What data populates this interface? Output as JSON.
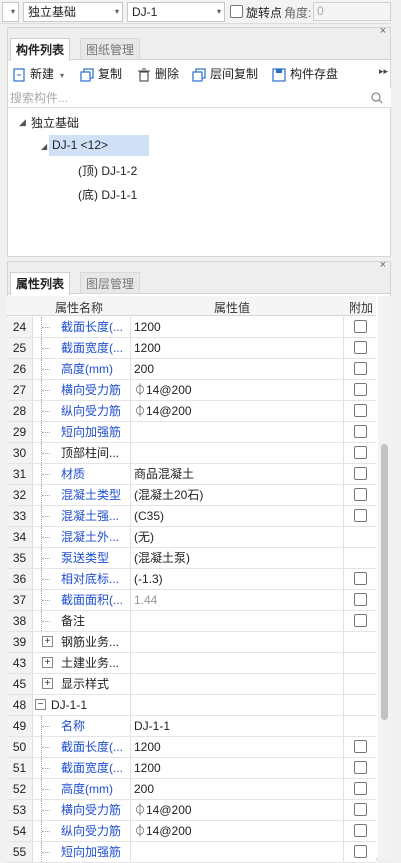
{
  "toolbar": {
    "category": "独立基础",
    "component": "DJ-1",
    "rotate_point_label": "旋转点",
    "angle_label": "角度:",
    "angle_value": "0"
  },
  "component_panel": {
    "tabs": [
      "构件列表",
      "图纸管理"
    ],
    "actions": {
      "new": "新建",
      "copy": "复制",
      "delete": "删除",
      "floor_copy": "层间复制",
      "save": "构件存盘"
    },
    "search_placeholder": "搜索构件...",
    "tree": {
      "root": "独立基础",
      "selected": "DJ-1 <12>",
      "children": [
        "(顶) DJ-1-2",
        "(底) DJ-1-1"
      ]
    }
  },
  "property_panel": {
    "tabs": [
      "属性列表",
      "图层管理"
    ],
    "columns": [
      "属性名称",
      "属性值",
      "附加"
    ],
    "rows": [
      {
        "num": "24",
        "name": "截面长度(...",
        "value": "1200",
        "style": "blue",
        "check": true
      },
      {
        "num": "25",
        "name": "截面宽度(...",
        "value": "1200",
        "style": "blue",
        "check": true
      },
      {
        "num": "26",
        "name": "高度(mm)",
        "value": "200",
        "style": "blue",
        "check": true
      },
      {
        "num": "27",
        "name": "横向受力筋",
        "value": "⏀14@200",
        "style": "blue",
        "check": true
      },
      {
        "num": "28",
        "name": "纵向受力筋",
        "value": "⏀14@200",
        "style": "blue",
        "check": true
      },
      {
        "num": "29",
        "name": "短向加强筋",
        "value": "",
        "style": "blue",
        "check": true
      },
      {
        "num": "30",
        "name": "顶部柱间...",
        "value": "",
        "style": "black",
        "check": true
      },
      {
        "num": "31",
        "name": "材质",
        "value": "商品混凝土",
        "style": "blue",
        "check": true
      },
      {
        "num": "32",
        "name": "混凝土类型",
        "value": "(混凝土20石)",
        "style": "blue",
        "check": true
      },
      {
        "num": "33",
        "name": "混凝土强...",
        "value": "(C35)",
        "style": "blue",
        "check": true
      },
      {
        "num": "34",
        "name": "混凝土外...",
        "value": "(无)",
        "style": "blue",
        "check": false
      },
      {
        "num": "35",
        "name": "泵送类型",
        "value": "(混凝土泵)",
        "style": "blue",
        "check": false
      },
      {
        "num": "36",
        "name": "相对底标...",
        "value": "(-1.3)",
        "style": "blue",
        "check": true
      },
      {
        "num": "37",
        "name": "截面面积(...",
        "value": "1.44",
        "style": "blue",
        "valgray": true,
        "check": true
      },
      {
        "num": "38",
        "name": "备注",
        "value": "",
        "style": "black",
        "check": true
      },
      {
        "num": "39",
        "name": "钢筋业务...",
        "value": "",
        "style": "black",
        "expand": "+",
        "check": false
      },
      {
        "num": "43",
        "name": "土建业务...",
        "value": "",
        "style": "black",
        "expand": "+",
        "check": false
      },
      {
        "num": "45",
        "name": "显示样式",
        "value": "",
        "style": "black",
        "expand": "+",
        "check": false
      },
      {
        "num": "48",
        "name": "DJ-1-1",
        "value": "",
        "style": "black",
        "expand": "−",
        "group": true,
        "check": false
      },
      {
        "num": "49",
        "name": "名称",
        "value": "DJ-1-1",
        "style": "blue",
        "check": false
      },
      {
        "num": "50",
        "name": "截面长度(...",
        "value": "1200",
        "style": "blue",
        "check": true
      },
      {
        "num": "51",
        "name": "截面宽度(...",
        "value": "1200",
        "style": "blue",
        "check": true
      },
      {
        "num": "52",
        "name": "高度(mm)",
        "value": "200",
        "style": "blue",
        "check": true
      },
      {
        "num": "53",
        "name": "横向受力筋",
        "value": "⏀14@200",
        "style": "blue",
        "check": true
      },
      {
        "num": "54",
        "name": "纵向受力筋",
        "value": "⏀14@200",
        "style": "blue",
        "check": true
      },
      {
        "num": "55",
        "name": "短向加强筋",
        "value": "",
        "style": "blue",
        "check": true
      }
    ]
  },
  "colors": {
    "accent_blue": "#1f4fd0",
    "selected_bg": "#cfe0f7"
  }
}
